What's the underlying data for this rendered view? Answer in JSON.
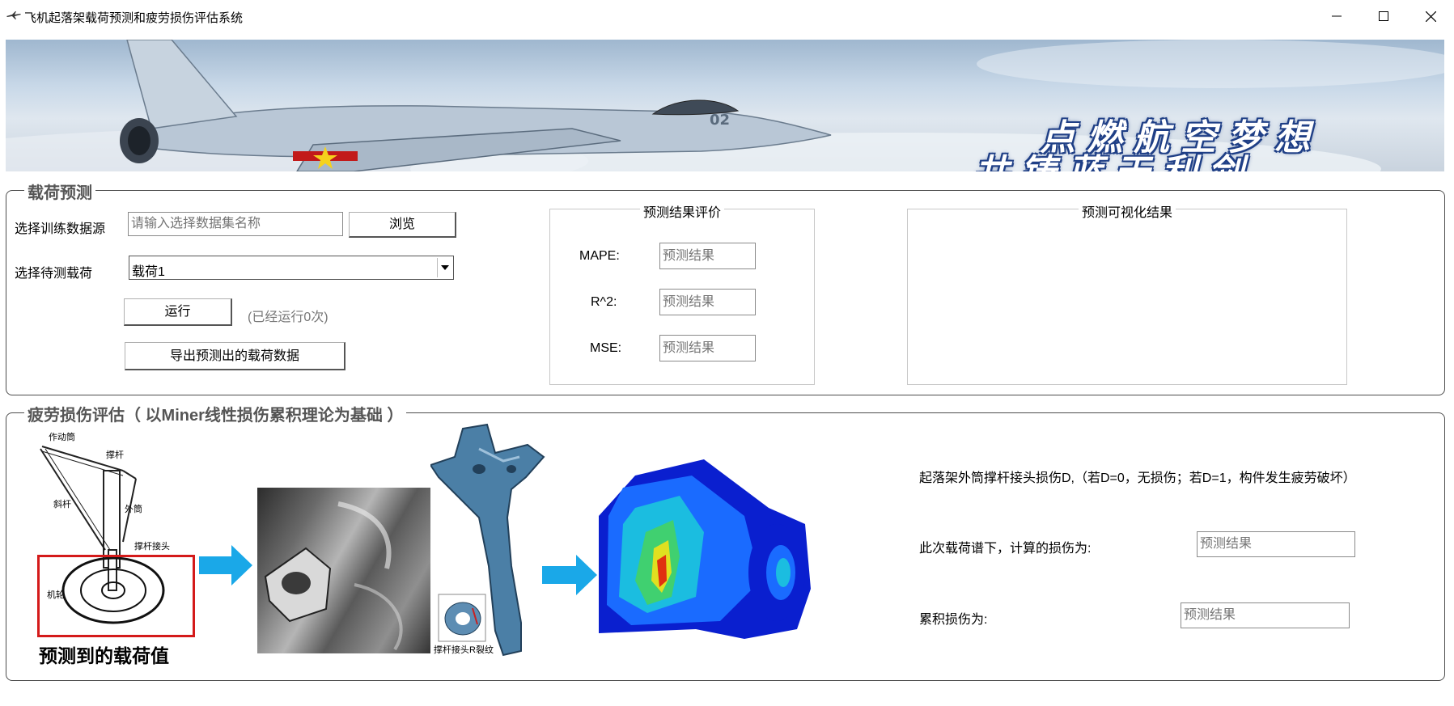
{
  "window": {
    "title": "飞机起落架载荷预测和疲劳损伤评估系统",
    "icon": "jet-icon",
    "minimize_icon": "minimize-icon",
    "maximize_icon": "maximize-icon",
    "close_icon": "close-icon"
  },
  "banner": {
    "slogan_line1": "点燃航空梦想",
    "slogan_line2": "共铸蓝天利剑"
  },
  "load_prediction": {
    "legend": "载荷预测",
    "dataset_label": "选择训练数据源",
    "dataset_placeholder": "请输入选择数据集名称",
    "browse_label": "浏览",
    "load_label": "选择待测载荷",
    "load_selected": "载荷1",
    "run_label": "运行",
    "run_count": "(已经运行0次)",
    "export_label": "导出预测出的载荷数据",
    "evaluation": {
      "title": "预测结果评价",
      "metrics": [
        {
          "label": "MAPE:",
          "placeholder": "预测结果"
        },
        {
          "label": "R^2:",
          "placeholder": "预测结果"
        },
        {
          "label": "MSE:",
          "placeholder": "预测结果"
        }
      ]
    },
    "visualization": {
      "title": "预测可视化结果"
    }
  },
  "fatigue": {
    "legend": "疲劳损伤评估（ 以Miner线性损伤累积理论为基础 ）",
    "diagram_caption": "预测到的载荷值",
    "sketch_labels": [
      "作动筒",
      "撑杆",
      "斜杆",
      "外筒",
      "撑杆接头",
      "机轮"
    ],
    "crack_label": "撑杆接头R裂纹",
    "description": "起落架外筒撑杆接头损伤D,（若D=0，无损伤；若D=1，构件发生疲劳破坏）",
    "current_damage_label": "此次载荷谱下，计算的损伤为:",
    "current_damage_placeholder": "预测结果",
    "cumulative_damage_label": "累积损伤为:",
    "cumulative_damage_placeholder": "预测结果"
  },
  "colors": {
    "arrow": "#1aa8e8",
    "highlight_box": "#d41a1a",
    "legend_text": "#555555",
    "slogan_outline": "#1f3f86"
  }
}
